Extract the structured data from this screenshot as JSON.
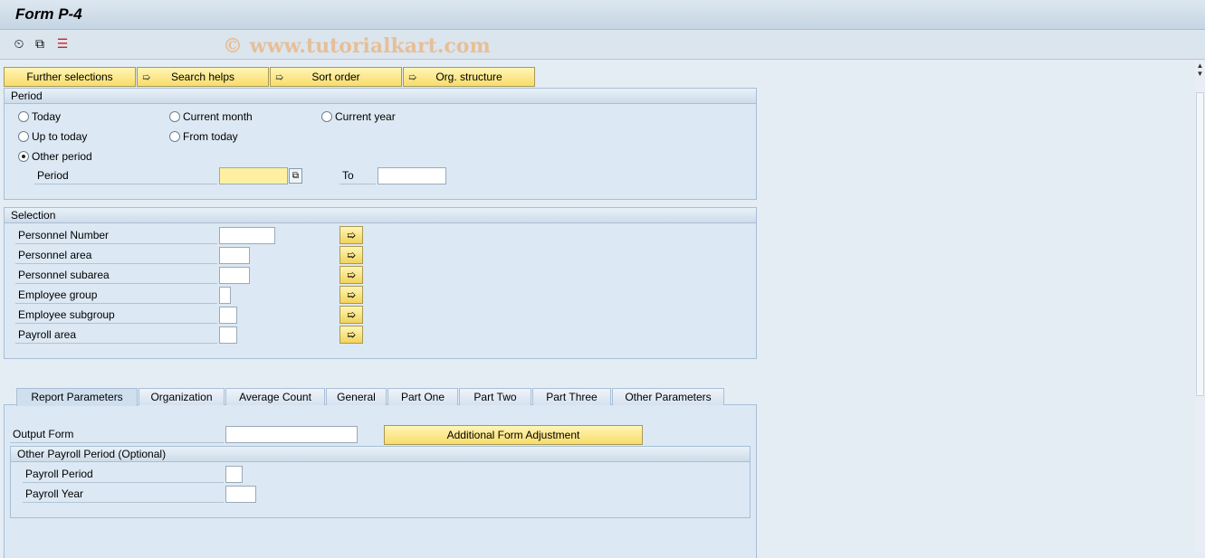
{
  "title": "Form P-4",
  "toolbar": {
    "icons": [
      "execute-icon",
      "copy-variant-icon",
      "selection-options-icon"
    ]
  },
  "watermark": "© www.tutorialkart.com",
  "buttons": {
    "further": "Further selections",
    "search": "Search helps",
    "sort": "Sort order",
    "org": "Org. structure"
  },
  "period": {
    "header": "Period",
    "today": "Today",
    "current_month": "Current month",
    "current_year": "Current year",
    "up_to_today": "Up to today",
    "from_today": "From today",
    "other_period": "Other period",
    "selected": "Other period",
    "period_label": "Period",
    "to_label": "To",
    "period_value": "",
    "to_value": ""
  },
  "selection": {
    "header": "Selection",
    "fields": [
      {
        "label": "Personnel Number",
        "value": ""
      },
      {
        "label": "Personnel area",
        "value": ""
      },
      {
        "label": "Personnel subarea",
        "value": ""
      },
      {
        "label": "Employee group",
        "value": ""
      },
      {
        "label": "Employee subgroup",
        "value": ""
      },
      {
        "label": "Payroll area",
        "value": ""
      }
    ]
  },
  "tabs": [
    "Report Parameters",
    "Organization",
    "Average Count",
    "General",
    "Part One",
    "Part Two",
    "Part Three",
    "Other Parameters"
  ],
  "active_tab": "Report Parameters",
  "report": {
    "output_form_label": "Output Form",
    "output_form_value": "",
    "additional_btn": "Additional Form Adjustment",
    "sub_header": "Other Payroll Period (Optional)",
    "payroll_period_label": "Payroll Period",
    "payroll_year_label": "Payroll Year"
  }
}
